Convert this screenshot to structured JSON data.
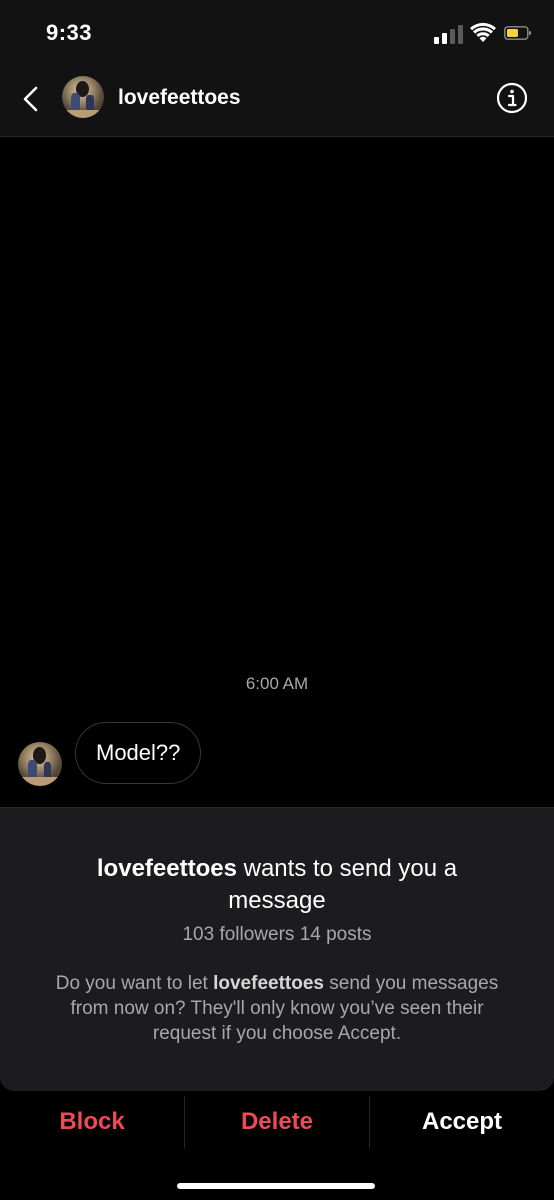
{
  "status_bar": {
    "time": "9:33"
  },
  "header": {
    "username": "lovefeettoes"
  },
  "conversation": {
    "timestamp": "6:00 AM",
    "messages": [
      {
        "text": "Model??"
      }
    ]
  },
  "request": {
    "username": "lovefeettoes",
    "title_rest": "wants to send you a message",
    "stats": "103 followers 14 posts",
    "desc_prefix": "Do you want to let",
    "desc_username": "lovefeettoes",
    "desc_suffix": "send you messages from now on? They'll only know you’ve seen their request if you choose Accept."
  },
  "actions": {
    "block": "Block",
    "delete": "Delete",
    "accept": "Accept"
  },
  "colors": {
    "destructive": "#ed4956",
    "accept": "#ffffff",
    "background": "#000000",
    "panel": "#1c1c1e"
  },
  "icons": {
    "back": "chevron-left-icon",
    "info": "info-circle-icon",
    "signal": "cellular-signal-icon",
    "wifi": "wifi-icon",
    "battery": "battery-icon"
  }
}
